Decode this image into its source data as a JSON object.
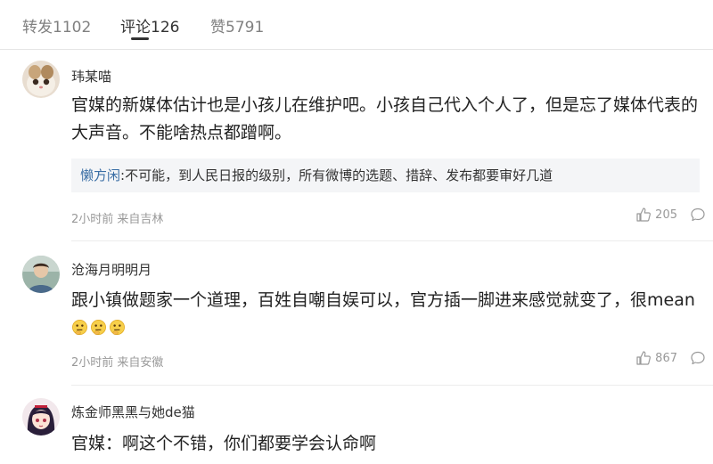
{
  "tabs": [
    {
      "label": "转发",
      "count": "1102"
    },
    {
      "label": "评论",
      "count": "126"
    },
    {
      "label": "赞",
      "count": "5791"
    }
  ],
  "comments": [
    {
      "username": "玮某喵",
      "text": "官媒的新媒体估计也是小孩儿在维护吧。小孩自己代入个人了，但是忘了媒体代表的大声音。不能啥热点都蹭啊。",
      "reply": {
        "author": "懒方闲",
        "text": ":不可能，到人民日报的级别，所有微博的选题、措辞、发布都要审好几道"
      },
      "meta": "2小时前 来自吉林",
      "likes": "205",
      "avatar_icon": "cat-photo"
    },
    {
      "username": "沧海月明明月",
      "text": "跟小镇做题家一个道理，百姓自嘲自娱可以，官方插一脚进来感觉就变了，很mean",
      "emoji_icons": [
        "thinking-face-icon",
        "thinking-face-icon",
        "thinking-face-icon"
      ],
      "meta": "2小时前 来自安徽",
      "likes": "867",
      "avatar_icon": "person-photo"
    },
    {
      "username": "炼金师黑黑与她de猫",
      "text": "官媒：啊这个不错，你们都要学会认命啊",
      "avatar_icon": "anime-girl-avatar"
    }
  ],
  "colors": {
    "reply_author": "#3a6ea5",
    "meta": "#999999",
    "reply_bg": "#f4f5f7",
    "tab_inactive": "#808080"
  }
}
